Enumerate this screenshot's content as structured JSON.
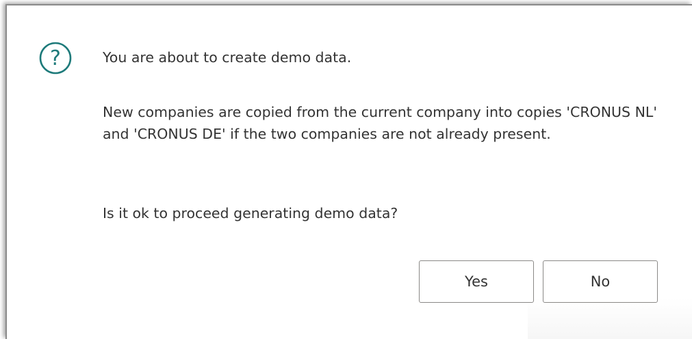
{
  "dialog": {
    "icon": "question-mark-circle-icon",
    "icon_glyph": "?",
    "accent_color": "#1d7a7a",
    "message_intro": "You are about to create demo data.",
    "message_detail": "New companies are copied from the current company into copies 'CRONUS NL' and 'CRONUS DE' if the two companies are not already present.",
    "message_question": "Is it ok to proceed generating demo data?",
    "buttons": {
      "yes_label": "Yes",
      "no_label": "No"
    }
  }
}
